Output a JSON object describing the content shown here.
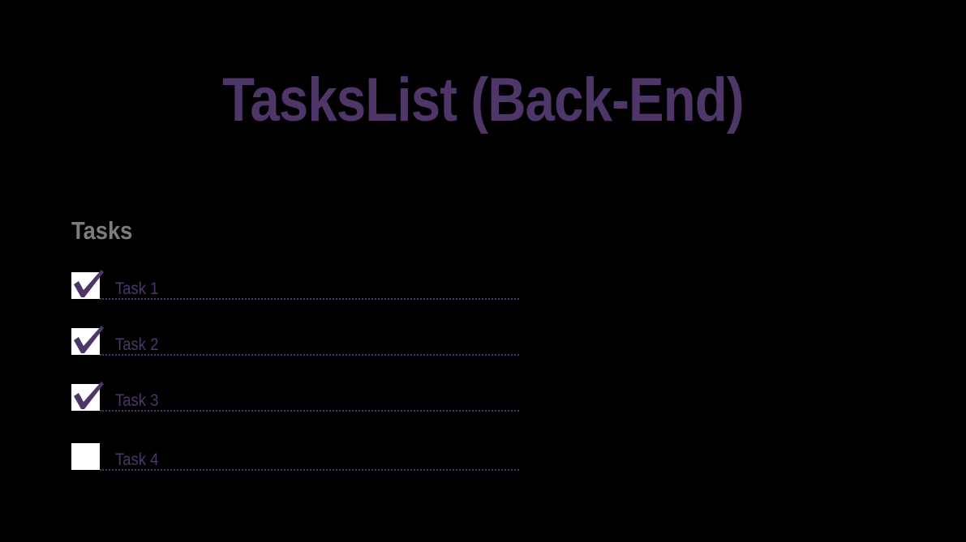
{
  "app": {
    "title": "TasksList (Back-End)"
  },
  "tasks_section": {
    "heading": "Tasks",
    "items": [
      {
        "label": "Task 1",
        "checked": true
      },
      {
        "label": "Task 2",
        "checked": true
      },
      {
        "label": "Task 3",
        "checked": true
      },
      {
        "label": "Task 4",
        "checked": false
      }
    ]
  },
  "icons": {
    "check": "check-icon"
  },
  "colors": {
    "background": "#000000",
    "accent": "#4e3668",
    "heading": "#7d7d7d",
    "checkbox": "#ffffff"
  }
}
